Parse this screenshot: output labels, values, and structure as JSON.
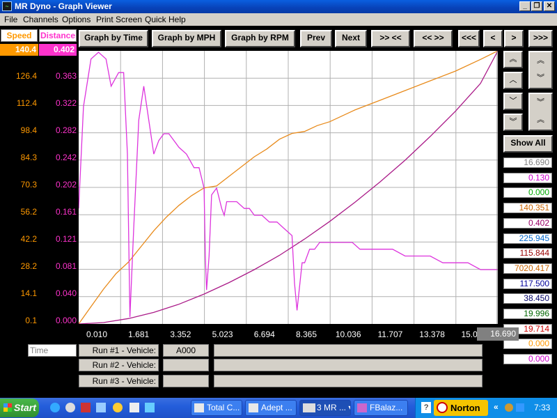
{
  "window": {
    "title": "MR Dyno - Graph Viewer",
    "controls": [
      "_",
      "❐",
      "✕"
    ]
  },
  "menu": [
    "File",
    "Channels",
    "Options",
    "Print Screen",
    "Quick Help"
  ],
  "toolbar": {
    "graph_by_time": "Graph by Time",
    "graph_by_mph": "Graph by MPH",
    "graph_by_rpm": "Graph by RPM",
    "prev": "Prev",
    "next": "Next",
    "zoom_in": ">> <<",
    "zoom_out": "<< >>",
    "scroll_start": "<<<",
    "scroll_left": "<",
    "scroll_right": ">",
    "scroll_end": ">>>"
  },
  "side_controls": {
    "up_double": "︽",
    "up": "︿",
    "down": "﹀",
    "down_double": "︾",
    "expand": "︽\n︾",
    "compress": "︾\n︽",
    "show_all": "Show All"
  },
  "scales": {
    "speed_header": "Speed",
    "distance_header": "Distance",
    "speed_top": "140.4",
    "distance_top": "0.402",
    "speed_labels": [
      "126.4",
      "112.4",
      "98.4",
      "84.3",
      "70.3",
      "56.2",
      "42.2",
      "28.2",
      "14.1",
      "0.1"
    ],
    "distance_labels": [
      "0.363",
      "0.322",
      "0.282",
      "0.242",
      "0.202",
      "0.161",
      "0.121",
      "0.081",
      "0.040",
      "0.000"
    ]
  },
  "x_axis": {
    "ticks": [
      "0.010",
      "1.681",
      "3.352",
      "5.023",
      "6.694",
      "8.365",
      "10.036",
      "11.707",
      "13.378",
      "15.049"
    ],
    "cursor_value": "16.690"
  },
  "readouts": [
    {
      "value": "16.690",
      "color": "#808080"
    },
    {
      "value": "0.130",
      "color": "#cc00cc"
    },
    {
      "value": "0.000",
      "color": "#00aa00"
    },
    {
      "value": "140.351",
      "color": "#cc6600"
    },
    {
      "value": "0.402",
      "color": "#990066"
    },
    {
      "value": "225.945",
      "color": "#0066cc"
    },
    {
      "value": "115.844",
      "color": "#990000"
    },
    {
      "value": "7020.417",
      "color": "#cc6600"
    },
    {
      "value": "117.500",
      "color": "#000099"
    },
    {
      "value": "38.450",
      "color": "#000066"
    },
    {
      "value": "19.996",
      "color": "#006600"
    },
    {
      "value": "19.714",
      "color": "#cc0000"
    },
    {
      "value": "0.000",
      "color": "#ff9900"
    },
    {
      "value": "0.000",
      "color": "#cc00cc"
    }
  ],
  "bottom": {
    "time_field": "Time",
    "runs": [
      {
        "label": "Run #1 - Vehicle:",
        "vehicle": "A000"
      },
      {
        "label": "Run #2 - Vehicle:",
        "vehicle": ""
      },
      {
        "label": "Run #3 - Vehicle:",
        "vehicle": ""
      }
    ]
  },
  "taskbar": {
    "start": "Start",
    "tasks": [
      "Total C...",
      "Adept ...",
      "3 MR ...",
      "FBalaz..."
    ],
    "norton": "Norton",
    "clock": "7:33"
  },
  "chart_data": {
    "type": "line",
    "xlim": [
      0.01,
      16.69
    ],
    "series": [
      {
        "color": "#e88a1a",
        "ylim": [
          0.1,
          140.4
        ],
        "x": [
          0.01,
          0.5,
          1.0,
          1.5,
          2.0,
          2.5,
          3.0,
          3.5,
          4.0,
          4.5,
          5.0,
          5.5,
          6.0,
          6.5,
          7.0,
          7.5,
          8.0,
          8.5,
          9.0,
          9.5,
          10.0,
          11.0,
          12.0,
          13.0,
          14.0,
          15.0,
          16.0,
          16.69
        ],
        "y": [
          0.1,
          9,
          18,
          26,
          32,
          40,
          48,
          55,
          61,
          66,
          70,
          71,
          76,
          81,
          86,
          90,
          95,
          98,
          99,
          102,
          104,
          110,
          115,
          120,
          125,
          130,
          136,
          140.4
        ]
      },
      {
        "color": "#aa1a88",
        "ylim": [
          0.0,
          0.402
        ],
        "x": [
          0.01,
          1,
          2,
          3,
          4,
          5,
          6,
          7,
          8,
          9,
          10,
          11,
          12,
          13,
          14,
          15,
          16,
          16.69
        ],
        "y": [
          0.0,
          0.002,
          0.008,
          0.017,
          0.029,
          0.044,
          0.061,
          0.08,
          0.101,
          0.125,
          0.151,
          0.179,
          0.209,
          0.241,
          0.276,
          0.313,
          0.354,
          0.402
        ]
      },
      {
        "color": "#dd33dd",
        "ylim": [
          0.0,
          0.402
        ],
        "x": [
          0.01,
          0.2,
          0.5,
          0.8,
          1.1,
          1.3,
          1.6,
          1.8,
          1.95,
          2.05,
          2.2,
          2.4,
          2.6,
          2.8,
          3.0,
          3.2,
          3.4,
          3.6,
          3.8,
          4.0,
          4.3,
          4.6,
          4.8,
          5.0,
          5.05,
          5.1,
          5.2,
          5.3,
          5.5,
          5.7,
          5.8,
          5.9,
          6.1,
          6.3,
          6.6,
          6.8,
          7.0,
          7.3,
          7.6,
          7.9,
          8.2,
          8.5,
          8.6,
          8.7,
          8.9,
          9.0,
          9.2,
          9.4,
          9.6,
          9.8,
          10.0,
          10.3,
          10.6,
          10.9,
          11.2,
          11.5,
          12.0,
          12.5,
          13.0,
          13.5,
          14.0,
          14.5,
          15.0,
          15.5,
          16.0,
          16.4,
          16.69
        ],
        "y": [
          0.17,
          0.32,
          0.39,
          0.4,
          0.39,
          0.35,
          0.37,
          0.37,
          0.25,
          0.01,
          0.14,
          0.3,
          0.35,
          0.3,
          0.25,
          0.27,
          0.28,
          0.28,
          0.27,
          0.26,
          0.25,
          0.23,
          0.23,
          0.2,
          0.1,
          0.05,
          0.1,
          0.19,
          0.2,
          0.17,
          0.16,
          0.18,
          0.18,
          0.18,
          0.17,
          0.17,
          0.16,
          0.16,
          0.15,
          0.15,
          0.14,
          0.13,
          0.06,
          0.02,
          0.09,
          0.09,
          0.11,
          0.11,
          0.12,
          0.12,
          0.12,
          0.12,
          0.12,
          0.12,
          0.11,
          0.11,
          0.11,
          0.11,
          0.1,
          0.1,
          0.1,
          0.09,
          0.09,
          0.09,
          0.08,
          0.08,
          0.08
        ]
      }
    ]
  }
}
